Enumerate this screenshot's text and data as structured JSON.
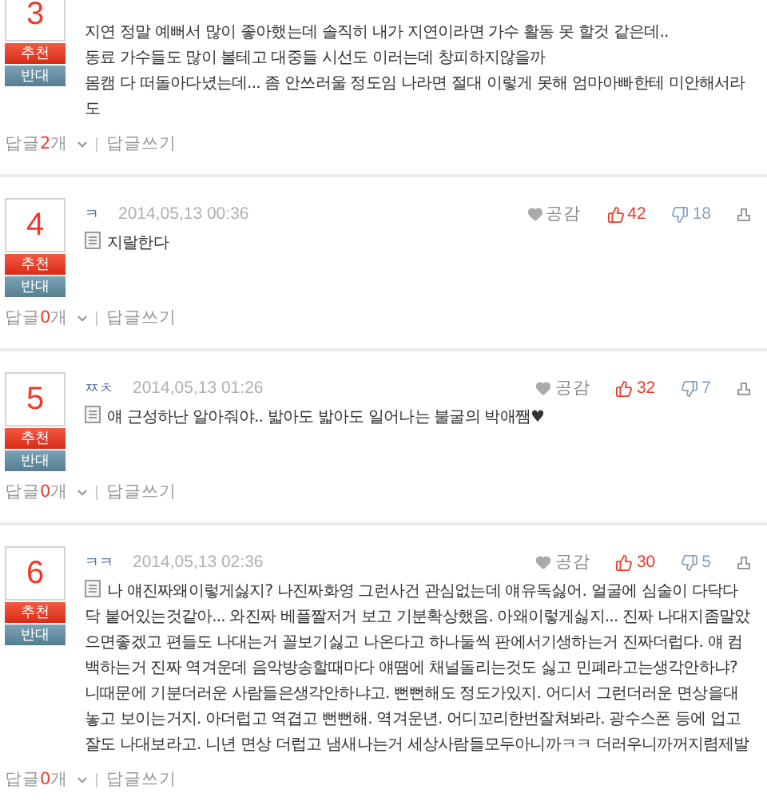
{
  "comments": [
    {
      "rank": "3",
      "body": "지연 정말 예뻐서 많이 좋아했는데 솔직히 내가 지연이라면 가수 활동 못 할것 같은데..\n동료 가수들도 많이 볼테고 대중들 시선도 이러는데 창피하지않을까\n몸캠 다 떠돌아다녔는데... 좀 안쓰러울 정도임 나라면 절대 이렇게 못해 엄마아빠한테 미안해서라도",
      "recommend": "추천",
      "oppose": "반대",
      "reply_label": "답글",
      "reply_count": "2",
      "reply_unit": "개",
      "write_reply": "답글쓰기"
    },
    {
      "rank": "4",
      "author": "ㅋ",
      "date": "2014,05,13 00:36",
      "empathy": "공감",
      "likes": "42",
      "dislikes": "18",
      "body": "지랄한다",
      "recommend": "추천",
      "oppose": "반대",
      "reply_label": "답글",
      "reply_count": "0",
      "reply_unit": "개",
      "write_reply": "답글쓰기"
    },
    {
      "rank": "5",
      "author": "ㅉㅊ",
      "date": "2014,05,13 01:26",
      "empathy": "공감",
      "likes": "32",
      "dislikes": "7",
      "body": "얘 근성하난 알아줘야.. 밟아도 밟아도 일어나는 불굴의 박애쨈♥",
      "recommend": "추천",
      "oppose": "반대",
      "reply_label": "답글",
      "reply_count": "0",
      "reply_unit": "개",
      "write_reply": "답글쓰기"
    },
    {
      "rank": "6",
      "author": "ㅋㅋ",
      "date": "2014,05,13 02:36",
      "empathy": "공감",
      "likes": "30",
      "dislikes": "5",
      "body": "나 얘진짜왜이렇게싫지? 나진짜화영 그런사건 관심없는데 얘유독싫어. 얼굴에 심술이 다닥다닥 붙어있는것같아... 와진짜 베플짤저거 보고 기분확상했음. 아왜이렇게싫지... 진짜 나대지좀말았으면좋겠고 편들도 나대는거 꼴보기싫고 나온다고 하나둘씩 판에서기생하는거 진짜더럽다. 얘 컴백하는거 진짜 역겨운데 음악방송할때마다 얘땜에 채널돌리는것도 싫고 민폐라고는생각안하냐? 니때문에 기분더러운 사람들은생각안하냐고. 뻔뻔해도 정도가있지. 어디서 그런더러운 면상을대놓고 보이는거지. 아더럽고 역겹고 뻔뻔해. 역겨운년. 어디꼬리한번잘쳐봐라. 광수스폰 등에 업고 잘도 나대보라고. 니년 면상 더럽고 냄새나는거 세상사람들모두아니까ㅋㅋ 더러우니까꺼지렴제발",
      "recommend": "추천",
      "oppose": "반대",
      "reply_label": "답글",
      "reply_count": "0",
      "reply_unit": "개",
      "write_reply": "답글쓰기"
    }
  ]
}
